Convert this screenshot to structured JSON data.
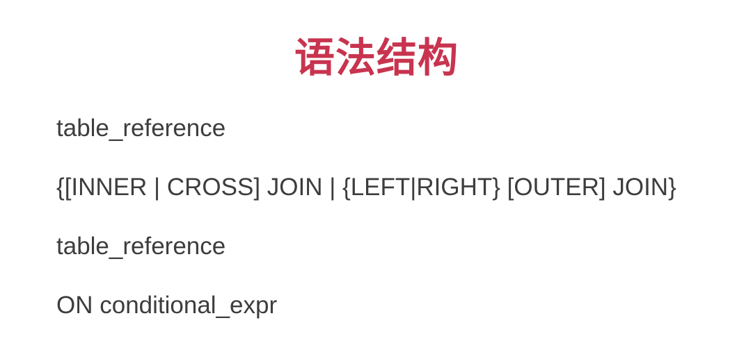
{
  "slide": {
    "title": "语法结构",
    "title_color": "#c8344f",
    "text_color": "#3d3d3d",
    "lines": [
      "table_reference",
      "{[INNER | CROSS] JOIN | {LEFT|RIGHT} [OUTER] JOIN}",
      "table_reference",
      "ON conditional_expr"
    ]
  }
}
